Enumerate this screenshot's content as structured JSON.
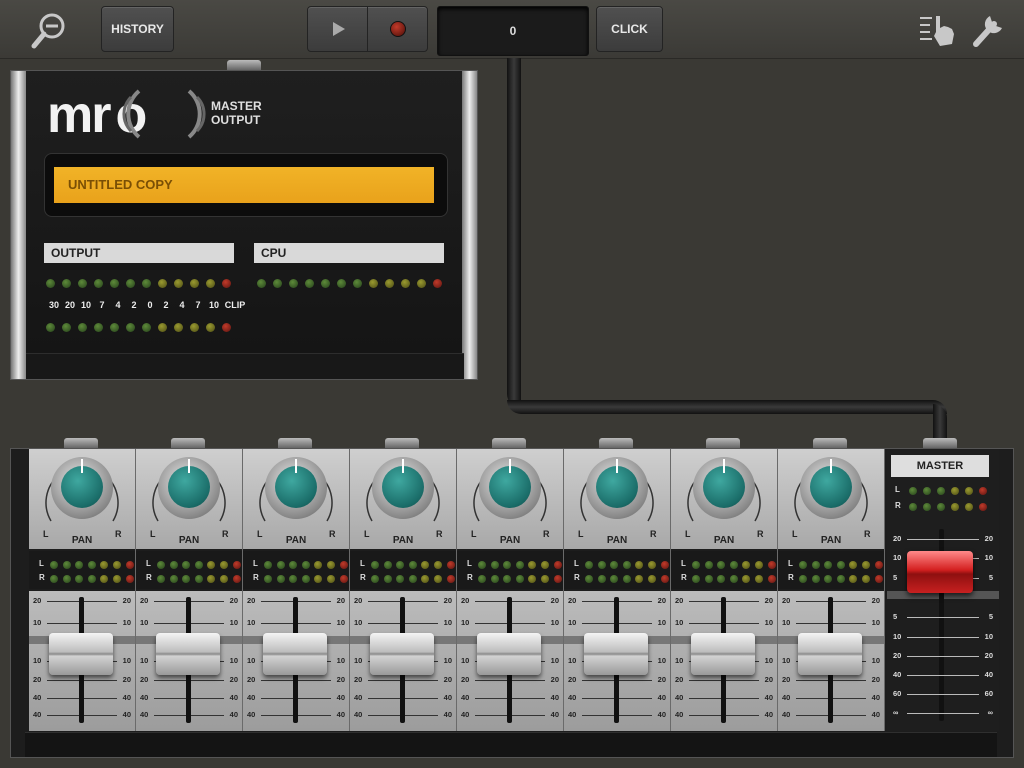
{
  "toolbar": {
    "history_label": "HISTORY",
    "counter_value": "0",
    "click_label": "CLICK"
  },
  "master_output": {
    "logo_text": "mr",
    "logo_o": "o",
    "title_line1": "MASTER",
    "title_line2": "OUTPUT",
    "project_name": "UNTITLED COPY",
    "output_label": "OUTPUT",
    "cpu_label": "CPU",
    "meter_scale": [
      "30",
      "20",
      "10",
      "7",
      "4",
      "2",
      "0",
      "2",
      "4",
      "7",
      "10",
      "CLIP"
    ]
  },
  "mixer": {
    "pan_label": "PAN",
    "pan_left": "L",
    "pan_right": "R",
    "meter_left": "L",
    "meter_right": "R",
    "channel_count": 8,
    "fader_scale_top": [
      "20",
      "10"
    ],
    "fader_scale_bottom": [
      "10",
      "20",
      "40",
      "40",
      "∞"
    ],
    "master_label": "MASTER",
    "master_scale_top": [
      "20",
      "10",
      "5"
    ],
    "master_scale_bottom": [
      "5",
      "10",
      "20",
      "40",
      "60",
      "∞"
    ]
  },
  "colors": {
    "background": "#3a3934",
    "lcd": "#efae22",
    "knob": "#2a8a84",
    "master_fader": "#d42020"
  }
}
